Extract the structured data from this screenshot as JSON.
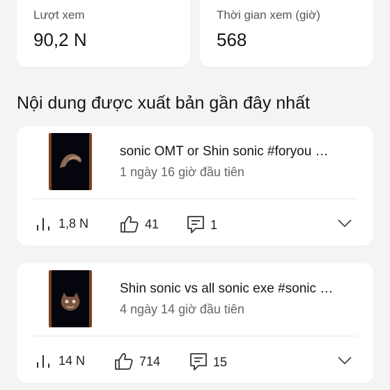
{
  "stats": {
    "views_label": "Lượt xem",
    "views_value": "90,2 N",
    "watch_label": "Thời gian xem (giờ)",
    "watch_value": "568"
  },
  "section_title": "Nội dung được xuất bản gần đây nhất",
  "videos": [
    {
      "title": "sonic OMT or Shin sonic #foryou …",
      "subtitle": "1 ngày 16 giờ đầu tiên",
      "views": "1,8 N",
      "likes": "41",
      "comments": "1"
    },
    {
      "title": "Shin sonic vs all sonic exe #sonic …",
      "subtitle": "4 ngày 14 giờ đầu tiên",
      "views": "14 N",
      "likes": "714",
      "comments": "15"
    }
  ],
  "colors": {
    "background": "#f4f4f4",
    "card": "#ffffff",
    "thumb_border": "#7a4322"
  },
  "icons": [
    "bar-chart-icon",
    "thumbs-up-icon",
    "comment-icon",
    "chevron-down-icon"
  ]
}
